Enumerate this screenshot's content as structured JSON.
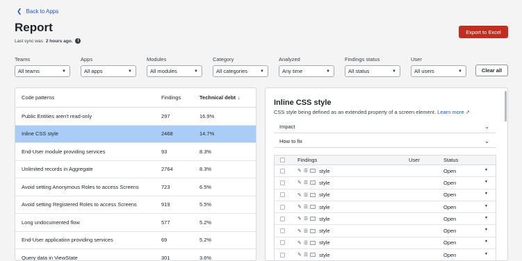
{
  "nav": {
    "back_label": "Back to Apps"
  },
  "header": {
    "title": "Report",
    "sync_prefix": "Last sync was",
    "sync_time": "2 hours ago.",
    "export_label": "Export to Excel"
  },
  "filters": [
    {
      "label": "Teams",
      "value": "All teams"
    },
    {
      "label": "Apps",
      "value": "All apps"
    },
    {
      "label": "Modules",
      "value": "All modules"
    },
    {
      "label": "Category",
      "value": "All categories"
    },
    {
      "label": "Analyzed",
      "value": "Any time"
    },
    {
      "label": "Findings status",
      "value": "All status"
    },
    {
      "label": "User",
      "value": "All users"
    }
  ],
  "clear_label": "Clear all",
  "patterns_table": {
    "columns": [
      "Code patterns",
      "Findings",
      "Technical debt"
    ],
    "rows": [
      {
        "name": "Public Entities aren't read-only",
        "findings": "297",
        "debt": "16.9%"
      },
      {
        "name": "Inline CSS style",
        "findings": "2468",
        "debt": "14.7%"
      },
      {
        "name": "End-User module providing services",
        "findings": "93",
        "debt": "8.3%"
      },
      {
        "name": "Unlimited records in Aggregate",
        "findings": "2764",
        "debt": "8.3%"
      },
      {
        "name": "Avoid setting Anonymous Roles to access Screens",
        "findings": "723",
        "debt": "6.5%"
      },
      {
        "name": "Avoid setting Registered Roles to access Screens",
        "findings": "919",
        "debt": "5.5%"
      },
      {
        "name": "Long undocumented flow",
        "findings": "577",
        "debt": "5.2%"
      },
      {
        "name": "End-User application providing services",
        "findings": "69",
        "debt": "5.2%"
      },
      {
        "name": "Query data in ViewState",
        "findings": "301",
        "debt": "3.6%"
      }
    ],
    "selected_index": 1
  },
  "detail": {
    "title": "Inline CSS style",
    "description": "CSS style being defined as an extended property of a screen element.",
    "learn_more": "Learn more",
    "accordions": [
      "Impact",
      "How to fix"
    ],
    "findings_table": {
      "columns": [
        "Findings",
        "User",
        "Status"
      ],
      "rows": [
        {
          "name": "style",
          "user": "",
          "status": "Open"
        },
        {
          "name": "style",
          "user": "",
          "status": "Open"
        },
        {
          "name": "style",
          "user": "",
          "status": "Open"
        },
        {
          "name": "style",
          "user": "",
          "status": "Open"
        },
        {
          "name": "style",
          "user": "",
          "status": "Open"
        },
        {
          "name": "style",
          "user": "",
          "status": "Open"
        },
        {
          "name": "style",
          "user": "",
          "status": "Open"
        },
        {
          "name": "style",
          "user": "",
          "status": "Open"
        }
      ]
    }
  },
  "colors": {
    "accent": "#1a56db",
    "export": "#c12d1e",
    "selected_row": "#a9cdf6"
  }
}
